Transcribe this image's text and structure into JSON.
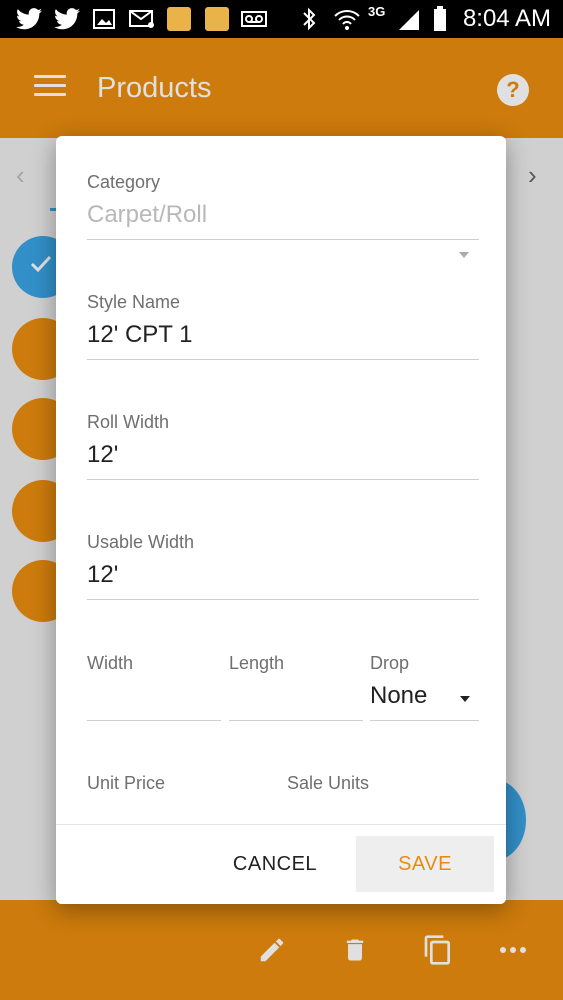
{
  "status_bar": {
    "time": "8:04 AM",
    "network": "3G"
  },
  "app_bar": {
    "title": "Products"
  },
  "dialog": {
    "category": {
      "label": "Category",
      "value": "Carpet/Roll"
    },
    "style_name": {
      "label": "Style Name",
      "value": "12' CPT 1"
    },
    "roll_width": {
      "label": "Roll Width",
      "value": "12'"
    },
    "usable_width": {
      "label": "Usable Width",
      "value": "12'"
    },
    "width": {
      "label": "Width",
      "value": ""
    },
    "length": {
      "label": "Length",
      "value": ""
    },
    "drop": {
      "label": "Drop",
      "value": "None"
    },
    "unit_price": {
      "label": "Unit Price"
    },
    "sale_units": {
      "label": "Sale Units"
    },
    "cancel_label": "CANCEL",
    "save_label": "SAVE"
  },
  "colors": {
    "accent": "#e98c0e",
    "blue": "#3aa3e3"
  }
}
